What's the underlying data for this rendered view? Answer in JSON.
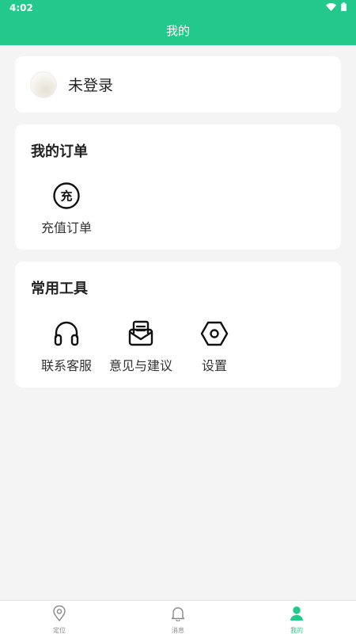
{
  "status_bar": {
    "time": "4:02"
  },
  "header": {
    "title": "我的"
  },
  "user": {
    "name": "未登录"
  },
  "orders": {
    "title": "我的订单",
    "items": [
      {
        "label": "充值订单",
        "icon": "recharge-icon",
        "glyph": "充"
      }
    ]
  },
  "tools": {
    "title": "常用工具",
    "items": [
      {
        "label": "联系客服",
        "icon": "headset-icon"
      },
      {
        "label": "意见与建议",
        "icon": "feedback-mail-icon"
      },
      {
        "label": "设置",
        "icon": "settings-hex-icon"
      }
    ]
  },
  "bottom_nav": {
    "items": [
      {
        "label": "定位",
        "icon": "location-pin-icon"
      },
      {
        "label": "消息",
        "icon": "bell-icon"
      },
      {
        "label": "我的",
        "icon": "user-icon"
      }
    ],
    "active_index": 2
  },
  "colors": {
    "accent": "#22c98a",
    "background": "#f4f4f4",
    "card": "#ffffff"
  }
}
